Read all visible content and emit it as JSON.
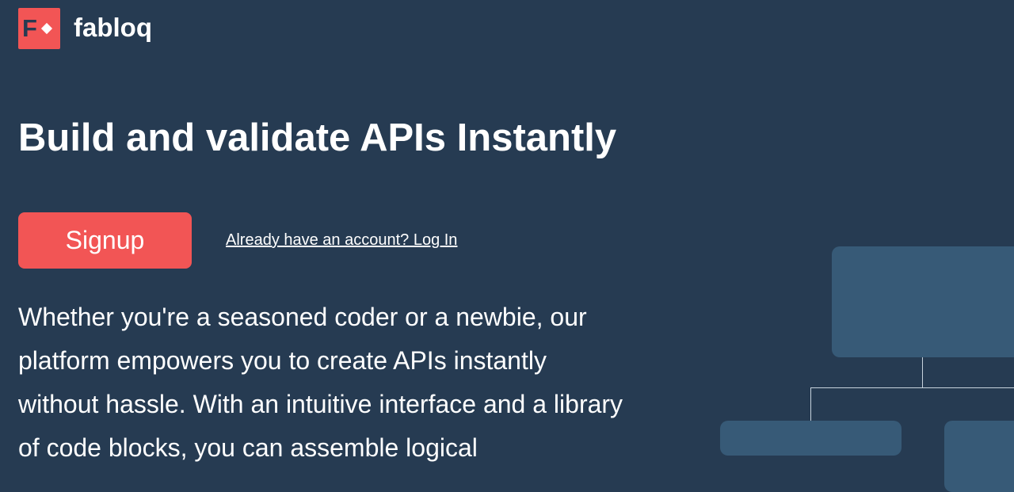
{
  "brand": {
    "logo_letter": "F",
    "name": "fabloq",
    "accent_color": "#f25555",
    "background_color": "#263b52",
    "card_color": "#375a77"
  },
  "hero": {
    "title": "Build and validate APIs Instantly",
    "signup_label": "Signup",
    "login_link": "Already have an account? Log In",
    "description": "Whether you're a seasoned coder or a newbie, our platform empowers you to create APIs instantly without hassle. With an intuitive interface and a library of code blocks, you can assemble logical"
  },
  "illustration": {
    "type": "flow-diagram",
    "description_icon": "node-tree-icon"
  }
}
